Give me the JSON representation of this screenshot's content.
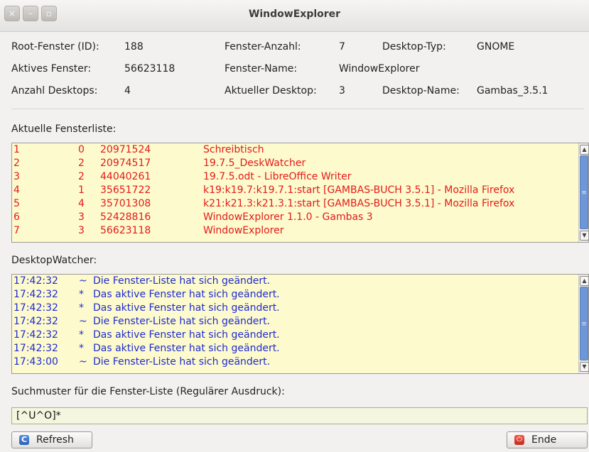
{
  "window": {
    "title": "WindowExplorer",
    "btn_close": "×",
    "btn_min": "–",
    "btn_max": "▫"
  },
  "info": {
    "root_label": "Root-Fenster (ID):",
    "root_value": "188",
    "count_label": "Fenster-Anzahl:",
    "count_value": "7",
    "dtype_label": "Desktop-Typ:",
    "dtype_value": "GNOME",
    "active_label": "Aktives Fenster:",
    "active_value": "56623118",
    "wname_label": "Fenster-Name:",
    "wname_value": "WindowExplorer",
    "ndesk_label": "Anzahl Desktops:",
    "ndesk_value": "4",
    "curdesk_label": "Aktueller Desktop:",
    "curdesk_value": "3",
    "dname_label": "Desktop-Name:",
    "dname_value": "Gambas_3.5.1"
  },
  "fensterliste": {
    "label": "Aktuelle Fensterliste:",
    "rows": [
      [
        "1",
        "0",
        "20971524",
        "Schreibtisch"
      ],
      [
        "2",
        "2",
        "20974517",
        "19.7.5_DeskWatcher"
      ],
      [
        "3",
        "2",
        "44040261",
        "19.7.5.odt - LibreOffice Writer"
      ],
      [
        "4",
        "1",
        "35651722",
        "k19:k19.7:k19.7.1:start [GAMBAS-BUCH 3.5.1] - Mozilla Firefox"
      ],
      [
        "5",
        "4",
        "35701308",
        "k21:k21.3:k21.3.1:start [GAMBAS-BUCH 3.5.1] - Mozilla Firefox"
      ],
      [
        "6",
        "3",
        "52428816",
        "WindowExplorer 1.1.0 - Gambas 3"
      ],
      [
        "7",
        "3",
        "56623118",
        "WindowExplorer"
      ]
    ]
  },
  "watcher": {
    "label": "DesktopWatcher:",
    "rows": [
      [
        "17:42:32",
        "~",
        "Die Fenster-Liste hat sich geändert."
      ],
      [
        "17:42:32",
        "*",
        "Das aktive Fenster hat sich geändert."
      ],
      [
        "17:42:32",
        "*",
        "Das aktive Fenster hat sich geändert."
      ],
      [
        "17:42:32",
        "~",
        "Die Fenster-Liste hat sich geändert."
      ],
      [
        "17:42:32",
        "*",
        "Das aktive Fenster hat sich geändert."
      ],
      [
        "17:42:32",
        "*",
        "Das aktive Fenster hat sich geändert."
      ],
      [
        "17:43:00",
        "~",
        "Die Fenster-Liste hat sich geändert."
      ]
    ]
  },
  "search": {
    "label": "Suchmuster für die Fenster-Liste (Regulärer Ausdruck):",
    "value": "[^U^O]*"
  },
  "buttons": {
    "refresh": "Refresh",
    "ende": "Ende"
  },
  "colors": {
    "list_bg": "#fdfacd",
    "list_text": "#e21b1b",
    "watch_text": "#1f2bd1",
    "scroll_thumb": "#6f97d8"
  }
}
